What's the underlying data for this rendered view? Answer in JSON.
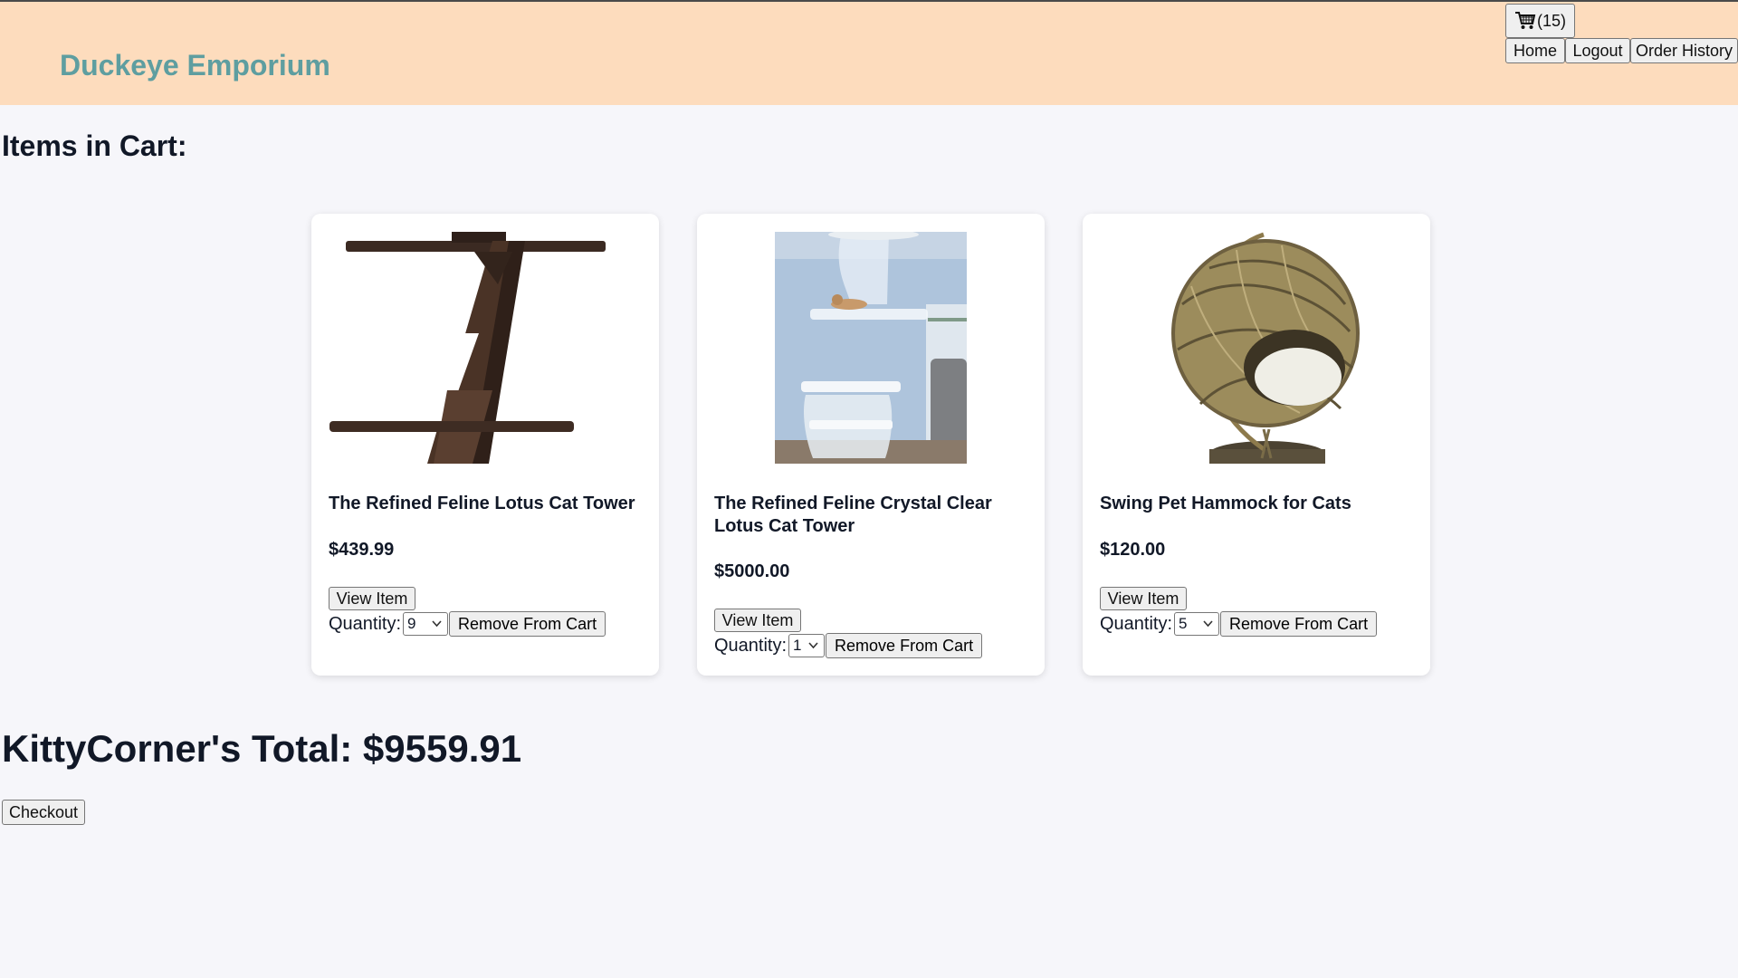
{
  "header": {
    "brand": "Duckeye Emporium",
    "cart_count": "(15)",
    "cart_icon": "shopping-cart-icon",
    "nav": {
      "home": "Home",
      "logout": "Logout",
      "order_history": "Order History"
    }
  },
  "main": {
    "heading": "Items in Cart:",
    "items": [
      {
        "name": "The Refined Feline Lotus Cat Tower",
        "price": "$439.99",
        "view_label": "View Item",
        "quantity_label": "Quantity:",
        "quantity": "9",
        "remove_label": "Remove From Cart"
      },
      {
        "name": "The Refined Feline Crystal Clear Lotus Cat Tower",
        "price": "$5000.00",
        "view_label": "View Item",
        "quantity_label": "Quantity:",
        "quantity": "1",
        "remove_label": "Remove From Cart"
      },
      {
        "name": "Swing Pet Hammock for Cats",
        "price": "$120.00",
        "view_label": "View Item",
        "quantity_label": "Quantity:",
        "quantity": "5",
        "remove_label": "Remove From Cart"
      }
    ],
    "total": "KittyCorner's Total: $9559.91",
    "checkout_label": "Checkout"
  },
  "colors": {
    "header_bg": "#fddcbd",
    "brand": "#5e9ea0",
    "page_bg": "#f6f6fa"
  }
}
